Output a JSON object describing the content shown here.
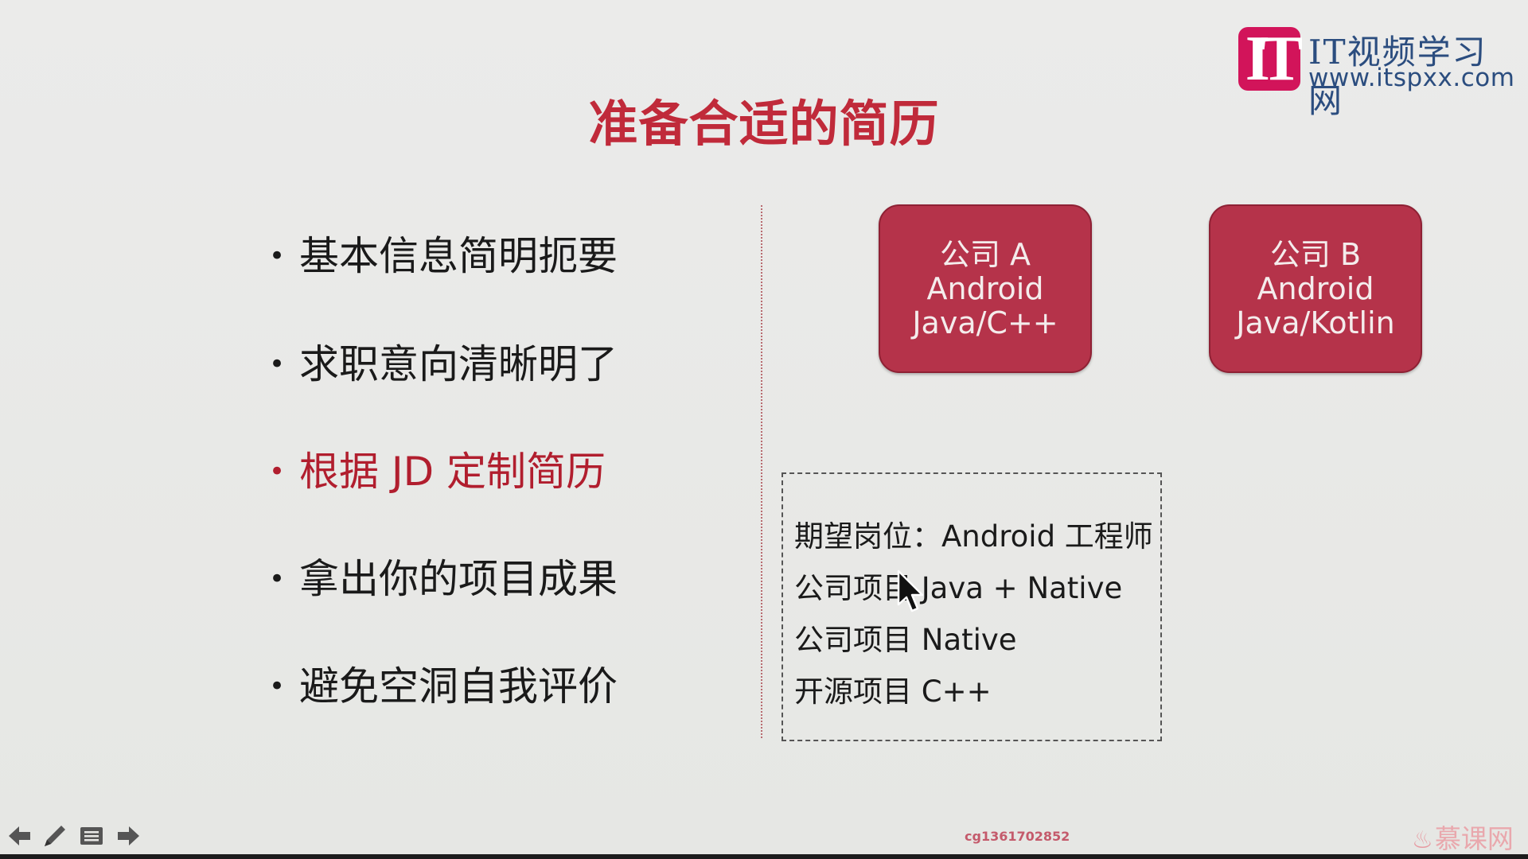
{
  "slide": {
    "title": "准备合适的简历",
    "bullets": [
      {
        "text": "基本信息简明扼要",
        "active": false
      },
      {
        "text": "求职意向清晰明了",
        "active": false
      },
      {
        "text": "根据 JD 定制简历",
        "active": true
      },
      {
        "text": "拿出你的项目成果",
        "active": false
      },
      {
        "text": "避免空洞自我评价",
        "active": false
      }
    ],
    "companies": [
      {
        "lines": [
          "公司 A",
          "Android",
          "Java/C++"
        ]
      },
      {
        "lines": [
          "公司 B",
          "Android",
          "Java/Kotlin"
        ]
      }
    ],
    "resume_lines": [
      "期望岗位：Android 工程师",
      "公司项目 Java + Native",
      "公司项目 Native",
      "开源项目 C++"
    ]
  },
  "logo": {
    "name": "IT视频学习网",
    "url": "www.itspxx.com",
    "mark": "IT"
  },
  "watermark": "cg1361702852",
  "brand": "慕课网",
  "nav_icons": [
    "previous-arrow-icon",
    "pen-icon",
    "menu-icon",
    "next-arrow-icon"
  ],
  "colors": {
    "title": "#c02a3a",
    "company_box": "#b5334a",
    "active_bullet": "#b11e2e",
    "logo_mark": "#d2145a",
    "logo_text": "#2b4d7f"
  }
}
